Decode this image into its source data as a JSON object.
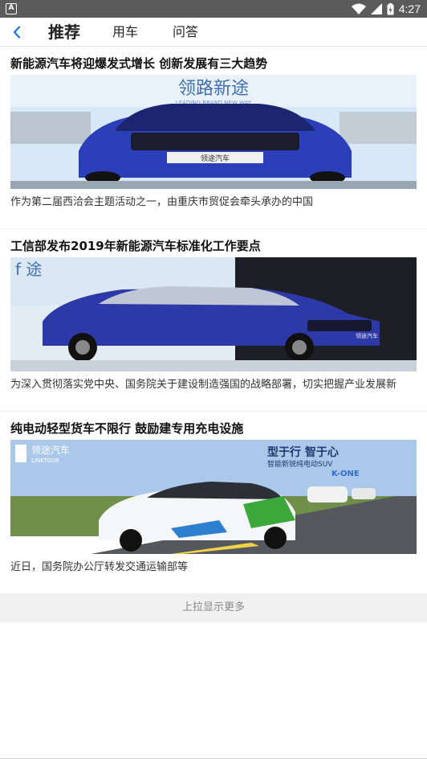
{
  "status_bar": {
    "time": "4:27",
    "notification_icon": "a-notification-icon",
    "icons": [
      "wifi-icon",
      "signal-icon",
      "battery-icon"
    ]
  },
  "nav": {
    "back_icon": "chevron-left-icon",
    "tabs": [
      {
        "label": "推荐",
        "active": true
      },
      {
        "label": "用车",
        "active": false
      },
      {
        "label": "问答",
        "active": false
      }
    ]
  },
  "articles": [
    {
      "title": "新能源汽车将迎爆发式增长 创新发展有三大趋势",
      "summary": "作为第二届西洽会主题活动之一，由重庆市贸促会牵头承办的中国",
      "image_banner": "领路新途",
      "image_sub": "LEADING BRAND NEW WAY",
      "car_plate": "领途汽车",
      "colors": {
        "car": "#2b3fb8",
        "bg": "#cfe3f5"
      }
    },
    {
      "title": "工信部发布2019年新能源汽车标准化工作要点",
      "summary": "为深入贯彻落实党中央、国务院关于建设制造强国的战略部署，切实把握产业发展新",
      "image_banner": "f 途",
      "car_plate": "领途汽车",
      "colors": {
        "car": "#2e39a8",
        "bg": "#d9e7f2"
      }
    },
    {
      "title": "纯电动轻型货车不限行 鼓励建专用充电设施",
      "summary": "近日，国务院办公厅转发交通运输部等",
      "image_brand": "领途汽车",
      "image_brand_en": "LINKTOUR",
      "image_slogan": "型于行 智于心",
      "image_slogan2": "智能新锐纯电动SUV",
      "image_model": "K-ONE",
      "colors": {
        "car": "#f4f6f8",
        "accent": "#3aa83a",
        "sky": "#a9c8ea"
      }
    }
  ],
  "load_more": "上拉显示更多"
}
